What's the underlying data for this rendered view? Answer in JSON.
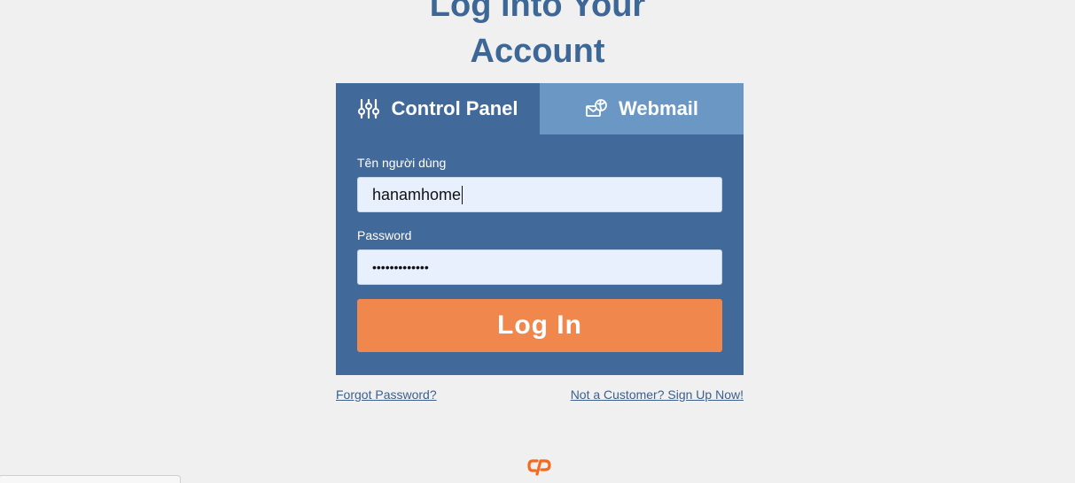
{
  "header": {
    "title_line1": "Log into Your",
    "title_line2": "Account"
  },
  "tabs": [
    {
      "label": "Control Panel",
      "icon": "sliders-icon",
      "active": true
    },
    {
      "label": "Webmail",
      "icon": "mail-globe-icon",
      "active": false
    }
  ],
  "form": {
    "username_label": "Tên người dùng",
    "username_value": "hanamhome",
    "password_label": "Password",
    "password_value": "•••••••••••••",
    "login_label": "Log In"
  },
  "links": {
    "forgot": "Forgot Password?",
    "signup": "Not a Customer? Sign Up Now!"
  },
  "colors": {
    "background": "#f0f0f0",
    "title": "#3d6796",
    "card": "#41699a",
    "tab_inactive": "#6a97c3",
    "input_bg": "#e8f0fe",
    "login_button": "#f0884e",
    "logo": "#f26b21"
  },
  "footer": {
    "logo_icon": "cpanel-logo-icon"
  }
}
